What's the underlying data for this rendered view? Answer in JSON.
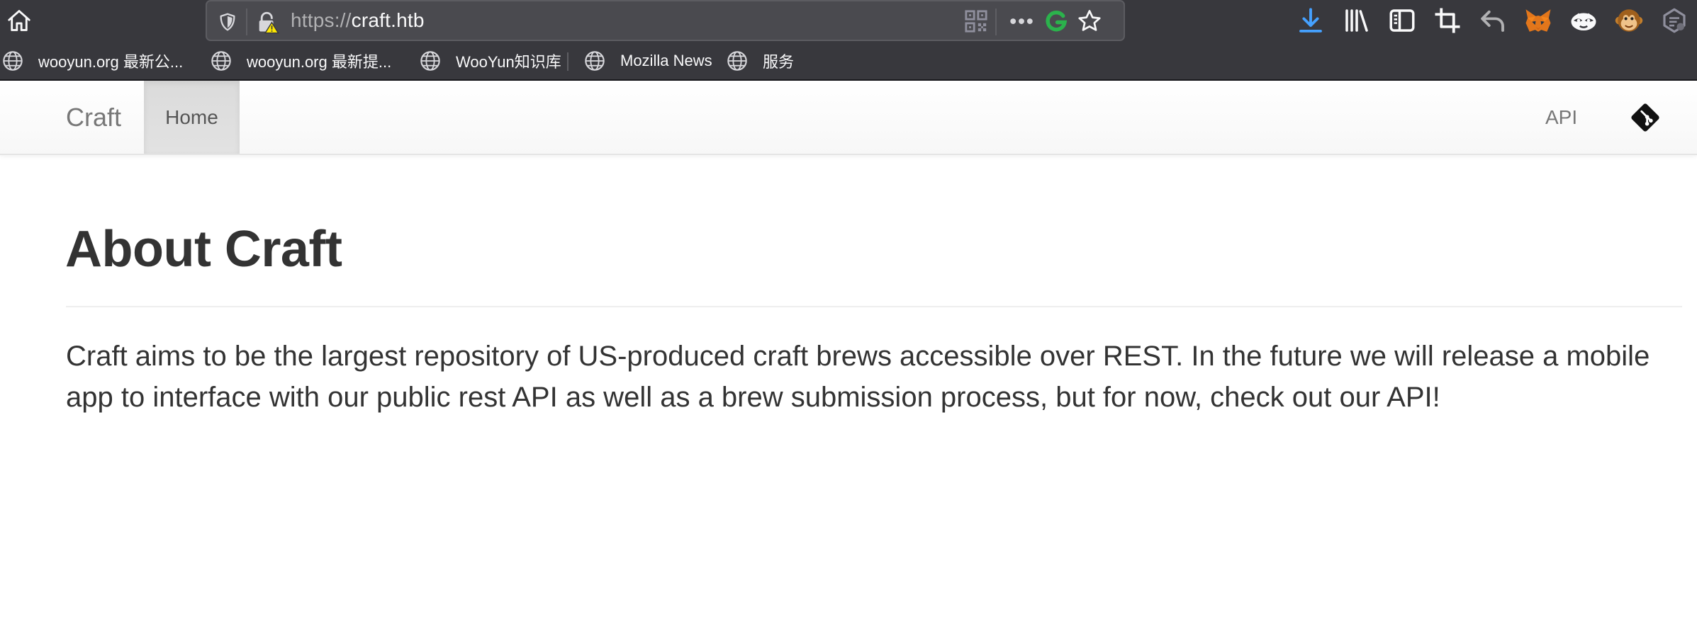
{
  "browser": {
    "url_scheme": "https://",
    "url_host": "craft.htb",
    "icons": {
      "home": "home-icon",
      "tracking": "shield-icon",
      "connection": "insecure-lock-icon",
      "qr": "qr-code-icon",
      "more": "ellipsis-icon",
      "grammarly": "grammarly-icon",
      "bookmark": "star-icon",
      "toolbar": [
        "download-icon",
        "library-icon",
        "sidebar-icon",
        "screenshot-icon",
        "back-icon",
        "metamask-icon",
        "extension-fox-icon",
        "tampermonkey-icon",
        "extension-icon"
      ]
    },
    "bookmarks": [
      {
        "label": "wooyun.org 最新公..."
      },
      {
        "label": "wooyun.org 最新提..."
      },
      {
        "label": "WooYun知识库"
      },
      {
        "label": "Mozilla News"
      },
      {
        "label": "服务"
      }
    ]
  },
  "navbar": {
    "brand": "Craft",
    "items": [
      {
        "label": "Home",
        "active": true
      }
    ],
    "right_items": [
      {
        "label": "API"
      }
    ],
    "git_icon": "git-icon"
  },
  "content": {
    "title": "About Craft",
    "lead": "Craft aims to be the largest repository of US-produced craft brews accessible over REST. In the future we will release a mobile app to interface with our public rest API as well as a brew submission process, but for now, check out our API!"
  },
  "colors": {
    "browser_chrome": "#38383d",
    "urlbar": "#4a4a4f",
    "download_accent": "#45a1ff",
    "grammarly": "#15c39a",
    "text": "#333333",
    "nav_text": "#777777"
  }
}
